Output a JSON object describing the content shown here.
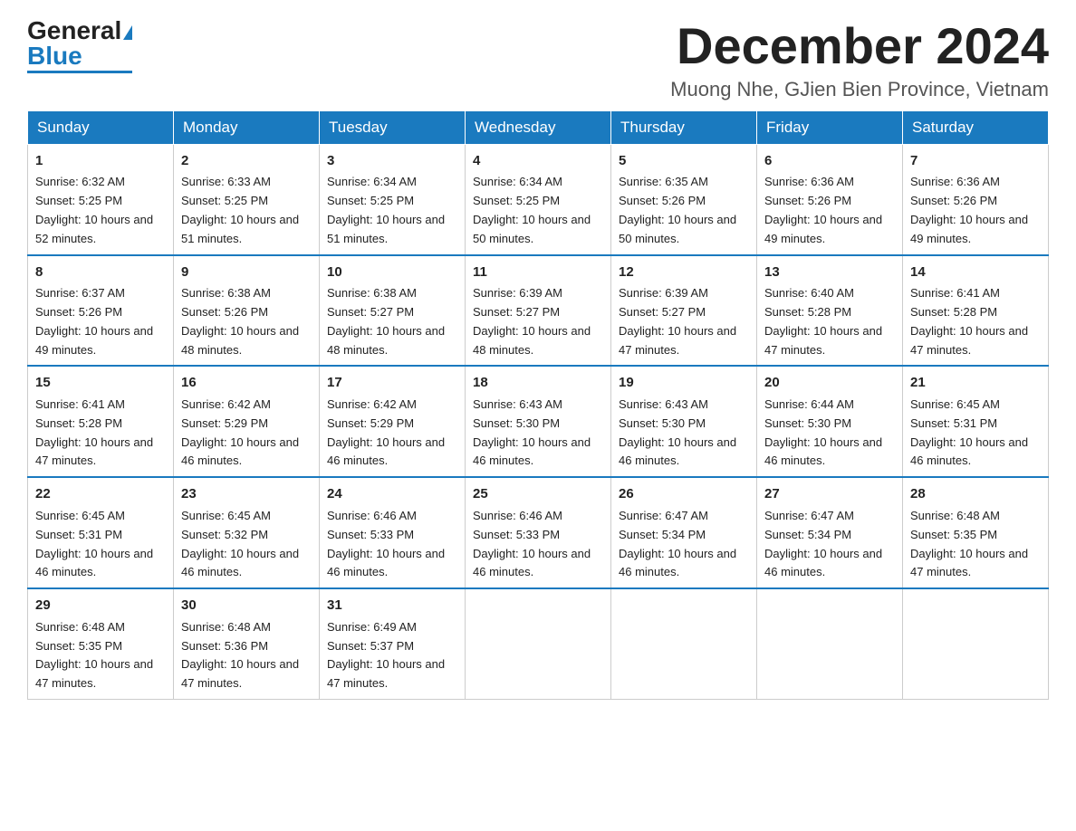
{
  "header": {
    "logo_general": "General",
    "logo_blue": "Blue",
    "month_title": "December 2024",
    "location": "Muong Nhe, GJien Bien Province, Vietnam"
  },
  "weekdays": [
    "Sunday",
    "Monday",
    "Tuesday",
    "Wednesday",
    "Thursday",
    "Friday",
    "Saturday"
  ],
  "weeks": [
    [
      {
        "day": "1",
        "sunrise": "6:32 AM",
        "sunset": "5:25 PM",
        "daylight": "10 hours and 52 minutes."
      },
      {
        "day": "2",
        "sunrise": "6:33 AM",
        "sunset": "5:25 PM",
        "daylight": "10 hours and 51 minutes."
      },
      {
        "day": "3",
        "sunrise": "6:34 AM",
        "sunset": "5:25 PM",
        "daylight": "10 hours and 51 minutes."
      },
      {
        "day": "4",
        "sunrise": "6:34 AM",
        "sunset": "5:25 PM",
        "daylight": "10 hours and 50 minutes."
      },
      {
        "day": "5",
        "sunrise": "6:35 AM",
        "sunset": "5:26 PM",
        "daylight": "10 hours and 50 minutes."
      },
      {
        "day": "6",
        "sunrise": "6:36 AM",
        "sunset": "5:26 PM",
        "daylight": "10 hours and 49 minutes."
      },
      {
        "day": "7",
        "sunrise": "6:36 AM",
        "sunset": "5:26 PM",
        "daylight": "10 hours and 49 minutes."
      }
    ],
    [
      {
        "day": "8",
        "sunrise": "6:37 AM",
        "sunset": "5:26 PM",
        "daylight": "10 hours and 49 minutes."
      },
      {
        "day": "9",
        "sunrise": "6:38 AM",
        "sunset": "5:26 PM",
        "daylight": "10 hours and 48 minutes."
      },
      {
        "day": "10",
        "sunrise": "6:38 AM",
        "sunset": "5:27 PM",
        "daylight": "10 hours and 48 minutes."
      },
      {
        "day": "11",
        "sunrise": "6:39 AM",
        "sunset": "5:27 PM",
        "daylight": "10 hours and 48 minutes."
      },
      {
        "day": "12",
        "sunrise": "6:39 AM",
        "sunset": "5:27 PM",
        "daylight": "10 hours and 47 minutes."
      },
      {
        "day": "13",
        "sunrise": "6:40 AM",
        "sunset": "5:28 PM",
        "daylight": "10 hours and 47 minutes."
      },
      {
        "day": "14",
        "sunrise": "6:41 AM",
        "sunset": "5:28 PM",
        "daylight": "10 hours and 47 minutes."
      }
    ],
    [
      {
        "day": "15",
        "sunrise": "6:41 AM",
        "sunset": "5:28 PM",
        "daylight": "10 hours and 47 minutes."
      },
      {
        "day": "16",
        "sunrise": "6:42 AM",
        "sunset": "5:29 PM",
        "daylight": "10 hours and 46 minutes."
      },
      {
        "day": "17",
        "sunrise": "6:42 AM",
        "sunset": "5:29 PM",
        "daylight": "10 hours and 46 minutes."
      },
      {
        "day": "18",
        "sunrise": "6:43 AM",
        "sunset": "5:30 PM",
        "daylight": "10 hours and 46 minutes."
      },
      {
        "day": "19",
        "sunrise": "6:43 AM",
        "sunset": "5:30 PM",
        "daylight": "10 hours and 46 minutes."
      },
      {
        "day": "20",
        "sunrise": "6:44 AM",
        "sunset": "5:30 PM",
        "daylight": "10 hours and 46 minutes."
      },
      {
        "day": "21",
        "sunrise": "6:45 AM",
        "sunset": "5:31 PM",
        "daylight": "10 hours and 46 minutes."
      }
    ],
    [
      {
        "day": "22",
        "sunrise": "6:45 AM",
        "sunset": "5:31 PM",
        "daylight": "10 hours and 46 minutes."
      },
      {
        "day": "23",
        "sunrise": "6:45 AM",
        "sunset": "5:32 PM",
        "daylight": "10 hours and 46 minutes."
      },
      {
        "day": "24",
        "sunrise": "6:46 AM",
        "sunset": "5:33 PM",
        "daylight": "10 hours and 46 minutes."
      },
      {
        "day": "25",
        "sunrise": "6:46 AM",
        "sunset": "5:33 PM",
        "daylight": "10 hours and 46 minutes."
      },
      {
        "day": "26",
        "sunrise": "6:47 AM",
        "sunset": "5:34 PM",
        "daylight": "10 hours and 46 minutes."
      },
      {
        "day": "27",
        "sunrise": "6:47 AM",
        "sunset": "5:34 PM",
        "daylight": "10 hours and 46 minutes."
      },
      {
        "day": "28",
        "sunrise": "6:48 AM",
        "sunset": "5:35 PM",
        "daylight": "10 hours and 47 minutes."
      }
    ],
    [
      {
        "day": "29",
        "sunrise": "6:48 AM",
        "sunset": "5:35 PM",
        "daylight": "10 hours and 47 minutes."
      },
      {
        "day": "30",
        "sunrise": "6:48 AM",
        "sunset": "5:36 PM",
        "daylight": "10 hours and 47 minutes."
      },
      {
        "day": "31",
        "sunrise": "6:49 AM",
        "sunset": "5:37 PM",
        "daylight": "10 hours and 47 minutes."
      },
      null,
      null,
      null,
      null
    ]
  ]
}
